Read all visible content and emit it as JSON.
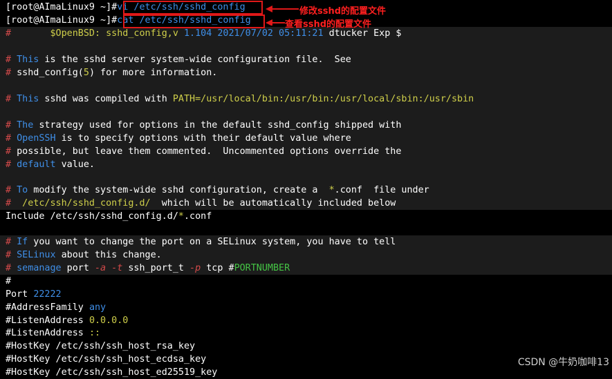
{
  "terminal": {
    "prompt": "[root@AImaLinux9 ~]#",
    "cmd1": "vi /etc/ssh/sshd_config",
    "cmd2": "cat /etc/ssh/sshd_config",
    "header_hash": "#",
    "header_text": "$OpenBSD: sshd_config,v ",
    "header_ver": "1.104 2021/07/02 05:11:21",
    "header_author": " dtucker Exp $",
    "l4_hash": "#",
    "l4_a": " This",
    "l4_b": " is the sshd server system-wide configuration file.  See",
    "l5_hash": "#",
    "l5_a": " sshd_config(",
    "l5_num": "5",
    "l5_b": ") for more information.",
    "l7_hash": "#",
    "l7_a": " This",
    "l7_b": " sshd was compiled with ",
    "l7_path": "PATH=/usr/local/bin:/usr/bin:/usr/local/sbin:/usr/sbin",
    "l9_hash": "#",
    "l9_a": " The",
    "l9_b": " strategy used for options in the default sshd_config shipped with",
    "l10_hash": "#",
    "l10_a": " OpenSSH",
    "l10_b": " is to specify options with their default value where",
    "l11": "# possible, but leave them commented.  Uncommented options override the",
    "l11_hash": "#",
    "l11_b": " possible, but leave them commented.  Uncommented options override the",
    "l12_hash": "#",
    "l12_a": " default",
    "l12_b": " value.",
    "l14_hash": "#",
    "l14_a": " To",
    "l14_b": " modify the system-wide sshd configuration, create a  ",
    "l14_star": "*",
    "l14_c": ".conf  file under",
    "l15_hash": "#",
    "l15_a": "  /etc/ssh/sshd_config.d/",
    "l15_b": "  which will be automatically included below",
    "l16_a": "Include /etc/ssh/sshd_config.d/",
    "l16_star": "*",
    "l16_b": ".conf",
    "l18_hash": "#",
    "l18_a": " If",
    "l18_b": " you want to change the port on a SELinux system, you have to tell",
    "l19_hash": "#",
    "l19_a": " SELinux",
    "l19_b": " about this change.",
    "l20_hash": "#",
    "l20_a": " semanage",
    "l20_b": " port ",
    "l20_c": "-a",
    "l20_d": " ",
    "l20_e": "-t",
    "l20_f": " ssh_port_t ",
    "l20_g": "-p",
    "l20_h": " tcp #",
    "l20_i": "PORTNUMBER",
    "l21": "#",
    "l22_a": "Port ",
    "l22_b": "22222",
    "l23_a": "#AddressFamily ",
    "l23_b": "any",
    "l24_a": "#ListenAddress ",
    "l24_b": "0.0.0.0",
    "l25_a": "#ListenAddress ",
    "l25_b": "::",
    "l26": "#HostKey /etc/ssh/ssh_host_rsa_key",
    "l27": "#HostKey /etc/ssh/ssh_host_ecdsa_key",
    "l28": "#HostKey /etc/ssh/ssh_host_ed25519_key"
  },
  "annotations": {
    "edit_label": "修改sshd的配置文件",
    "view_label": "查看sshd的配置文件"
  },
  "watermark": "CSDN @牛奶咖啡13",
  "colors": {
    "background": "#000000",
    "comment_hash": "#d44a4a",
    "keyword": "#3f8fe8",
    "number": "#cfcf4a",
    "path": "#cfcf4a",
    "string": "#45c445",
    "annotation_red": "#e01818"
  }
}
